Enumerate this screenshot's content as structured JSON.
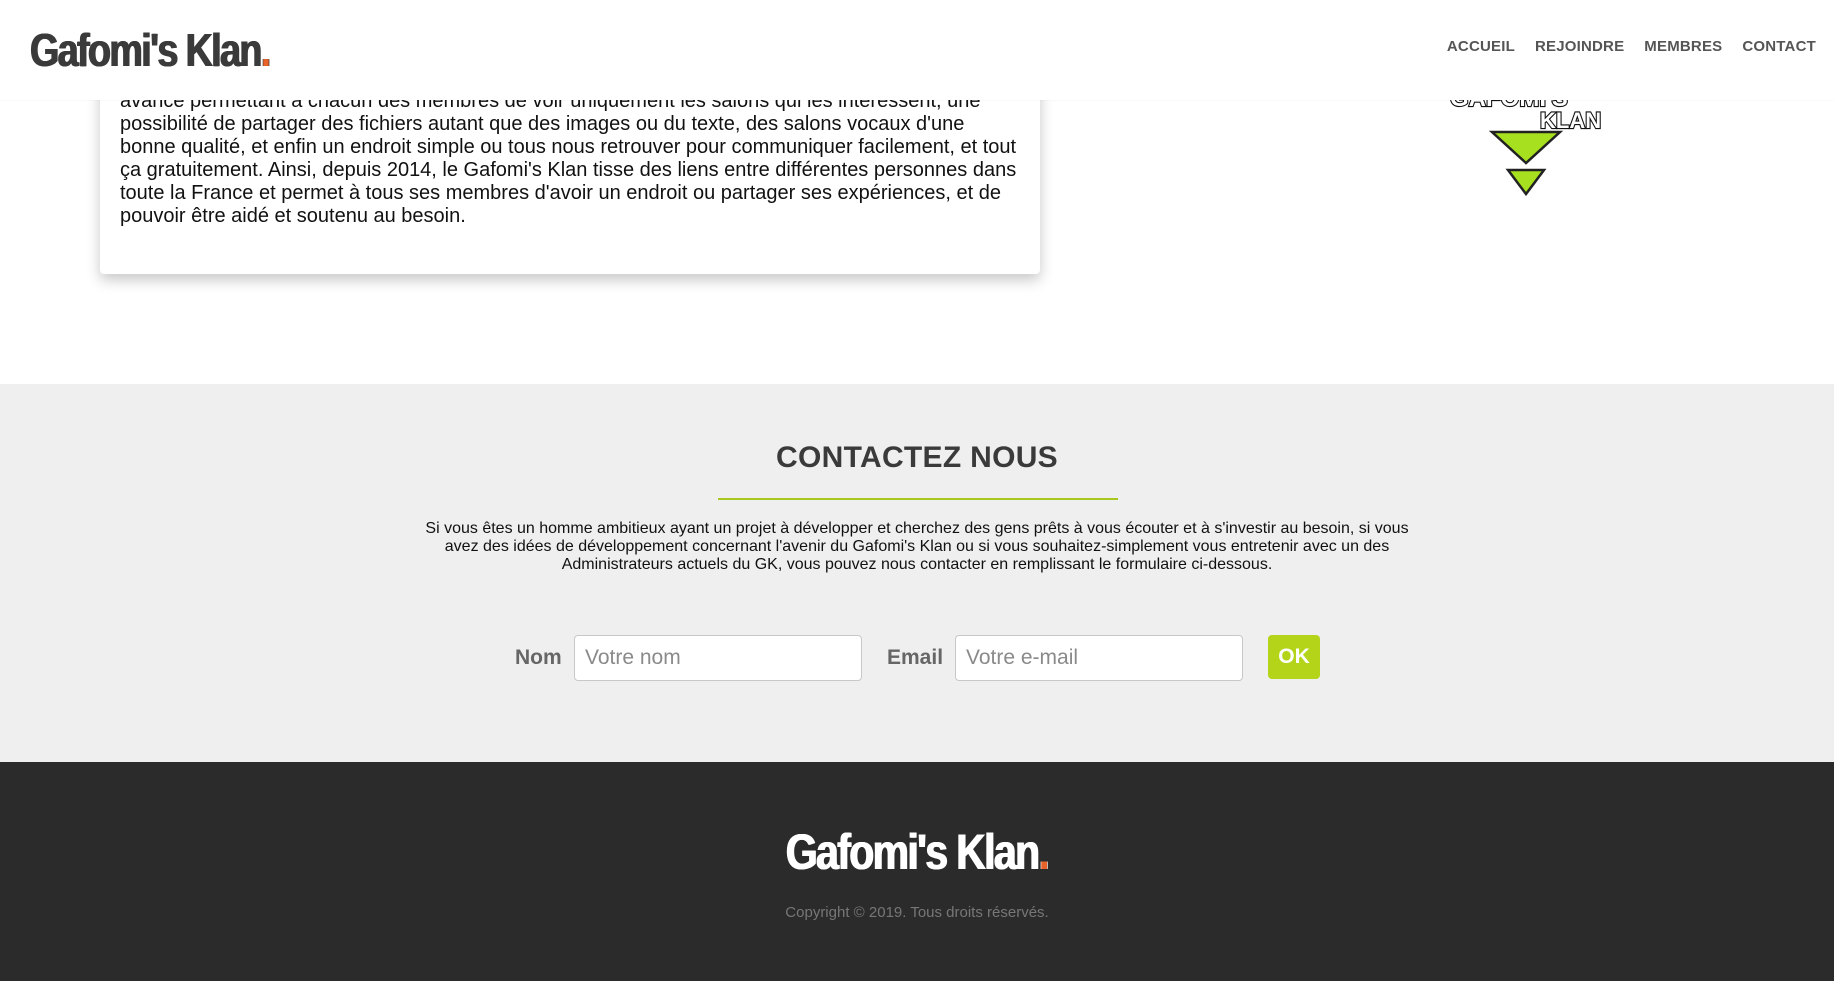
{
  "header": {
    "logo_text": "Gafomi's Klan",
    "logo_dot": ".",
    "nav": [
      {
        "label": "ACCUEIL"
      },
      {
        "label": "REJOINDRE"
      },
      {
        "label": "MEMBRES"
      },
      {
        "label": "CONTACT"
      }
    ]
  },
  "about": {
    "text": "avancé permettant à chacun des membres de voir uniquement les salons qui les intéressent, une possibilité de partager des fichiers autant que des images ou du texte, des salons vocaux d'une bonne qualité, et enfin un endroit simple ou tous nous retrouver pour communiquer facilement, et tout ça gratuitement. Ainsi, depuis 2014, le Gafomi's Klan tisse des liens entre différentes personnes dans toute la France et permet à tous ses membres d'avoir un endroit ou partager ses expériences, et de pouvoir être aidé et soutenu au besoin."
  },
  "emblem": {
    "line1": "GAFOMI'S",
    "line2": "KLAN",
    "color": "#a6e01e"
  },
  "contact": {
    "title": "CONTACTEZ NOUS",
    "description": "Si vous êtes un homme ambitieux ayant un projet à développer et cherchez des gens prêts à vous écouter et à s'investir au besoin, si vous avez des idées de développement concernant l'avenir du Gafomi's Klan ou si vous souhaitez-simplement vous entretenir avec un des Administrateurs actuels du GK, vous pouvez nous contacter en remplissant le formulaire ci-dessous.",
    "name_label": "Nom",
    "name_placeholder": "Votre nom",
    "email_label": "Email",
    "email_placeholder": "Votre e-mail",
    "submit_label": "OK",
    "accent_color": "#b4d41a"
  },
  "footer": {
    "logo_text": "Gafomi's Klan",
    "logo_dot": ".",
    "copyright": "Copyright © 2019. Tous droits réservés."
  },
  "colors": {
    "brand_dot": "#e8632a",
    "footer_bg": "#2b2b2b",
    "contact_bg": "#efefef"
  }
}
